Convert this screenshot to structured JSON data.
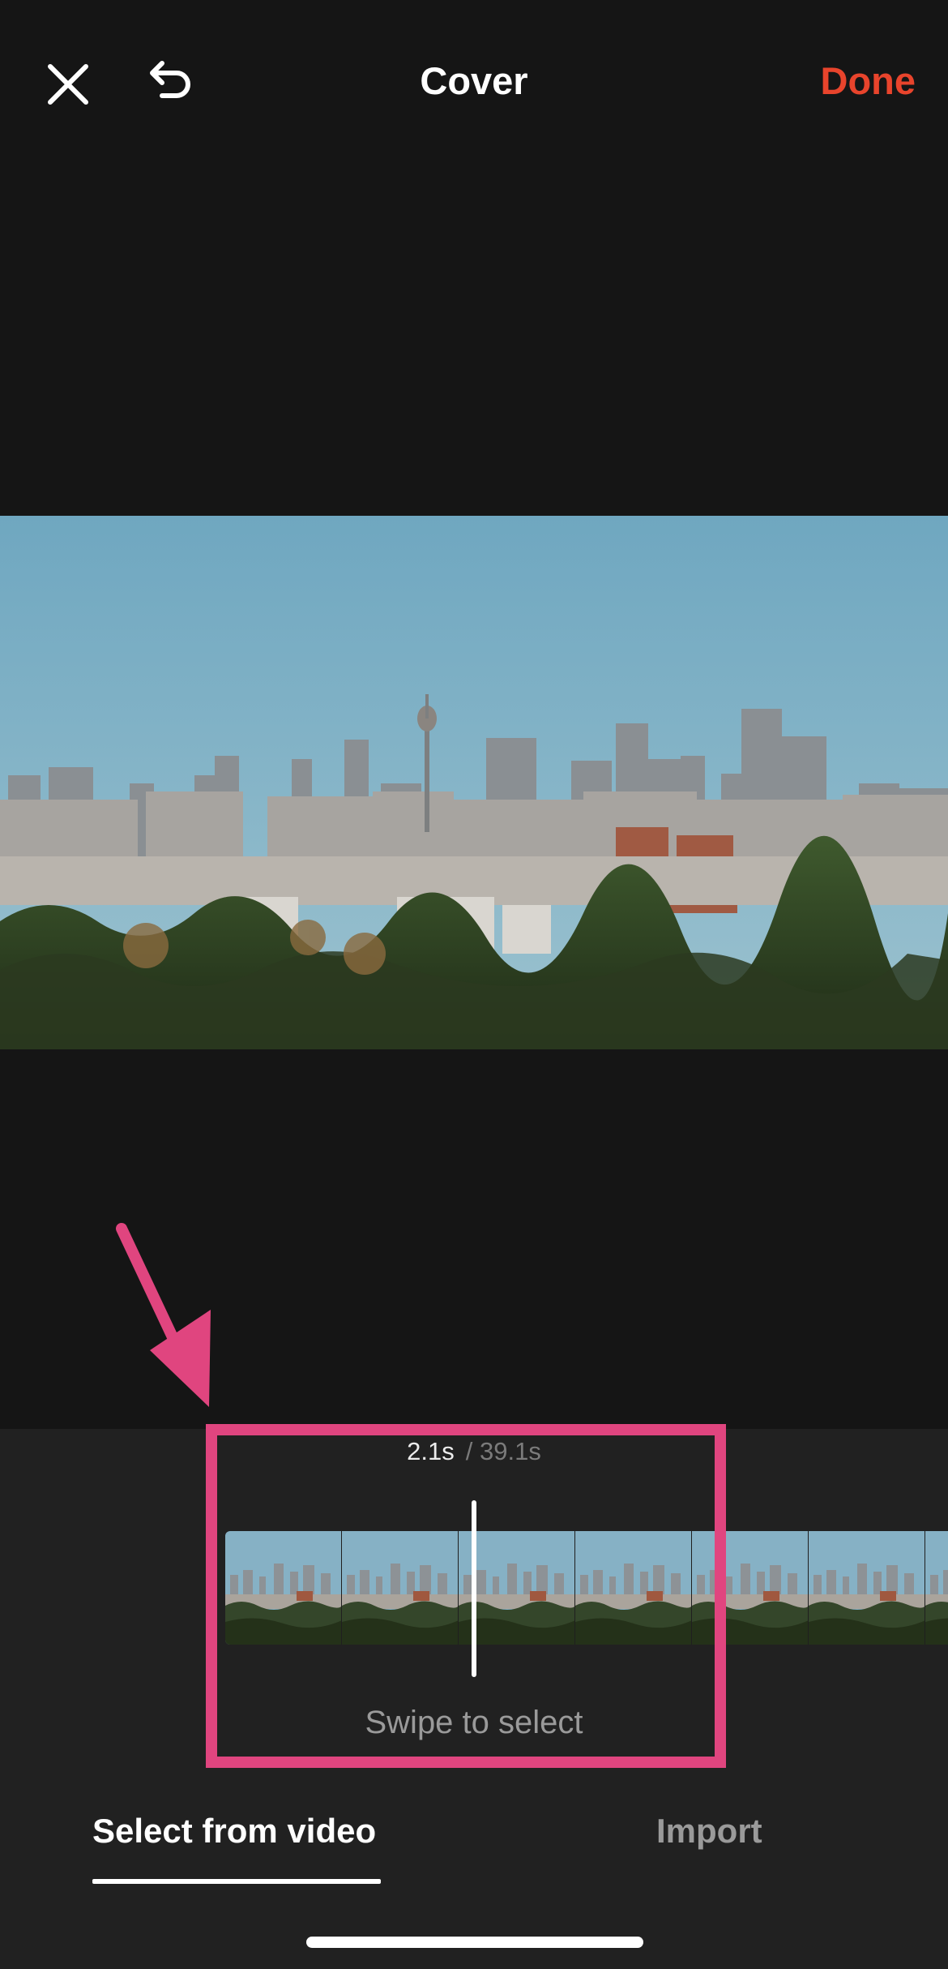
{
  "header": {
    "title": "Cover",
    "done_label": "Done",
    "close_icon": "close-icon",
    "undo_icon": "undo-icon"
  },
  "colors": {
    "accent": "#e8442c",
    "highlight": "#e0457f",
    "background": "#151515",
    "panel": "#212121"
  },
  "timeline": {
    "current_time": "2.1s",
    "total_time": "/ 39.1s",
    "hint": "Swipe to select",
    "frame_count": 7
  },
  "tabs": [
    {
      "label": "Select from video",
      "active": true
    },
    {
      "label": "Import",
      "active": false
    }
  ]
}
